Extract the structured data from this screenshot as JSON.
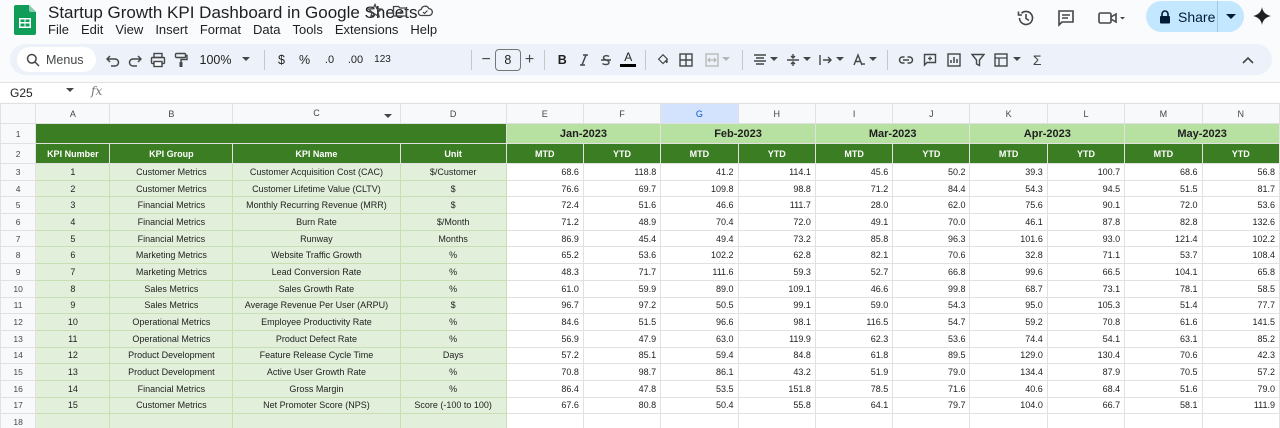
{
  "app": {
    "doc_title": "Startup Growth KPI Dashboard in Google Sheets",
    "menu": [
      "File",
      "Edit",
      "View",
      "Insert",
      "Format",
      "Data",
      "Tools",
      "Extensions",
      "Help"
    ],
    "share_label": "Share",
    "accent": "#3a7d22"
  },
  "toolbar": {
    "menus_label": "Menus",
    "zoom": "100%",
    "currency": "$",
    "percent": "%",
    "dec_decrease": ".0",
    "dec_increase": ".00",
    "number_format": "123",
    "font_size": "8",
    "bold": "B",
    "text_color": "A"
  },
  "formula_bar": {
    "name_box": "G25",
    "fx": "fx"
  },
  "sheet": {
    "columns": [
      "A",
      "B",
      "C",
      "D",
      "E",
      "F",
      "G",
      "H",
      "I",
      "J",
      "K",
      "L",
      "M",
      "N"
    ],
    "row_numbers": [
      "1",
      "2",
      "3",
      "4",
      "5",
      "6",
      "7",
      "8",
      "9",
      "10",
      "11",
      "12",
      "13",
      "14",
      "15",
      "16",
      "17",
      "18"
    ],
    "months": [
      "Jan-2023",
      "Feb-2023",
      "Mar-2023",
      "Apr-2023",
      "May-2023"
    ],
    "headers": {
      "kpi_number": "KPI Number",
      "kpi_group": "KPI Group",
      "kpi_name": "KPI Name",
      "unit": "Unit",
      "mtd": "MTD",
      "ytd": "YTD"
    },
    "rows": [
      {
        "num": "1",
        "group": "Customer Metrics",
        "name": "Customer Acquisition Cost (CAC)",
        "unit": "$/Customer",
        "vals": [
          "68.6",
          "118.8",
          "41.2",
          "114.1",
          "45.6",
          "50.2",
          "39.3",
          "100.7",
          "68.6",
          "56.8"
        ]
      },
      {
        "num": "2",
        "group": "Customer Metrics",
        "name": "Customer Lifetime Value (CLTV)",
        "unit": "$",
        "vals": [
          "76.6",
          "69.7",
          "109.8",
          "98.8",
          "71.2",
          "84.4",
          "54.3",
          "94.5",
          "51.5",
          "81.7"
        ]
      },
      {
        "num": "3",
        "group": "Financial Metrics",
        "name": "Monthly Recurring Revenue (MRR)",
        "unit": "$",
        "vals": [
          "72.4",
          "51.6",
          "46.6",
          "111.7",
          "28.0",
          "62.0",
          "75.6",
          "90.1",
          "72.0",
          "53.6"
        ]
      },
      {
        "num": "4",
        "group": "Financial Metrics",
        "name": "Burn Rate",
        "unit": "$/Month",
        "vals": [
          "71.2",
          "48.9",
          "70.4",
          "72.0",
          "49.1",
          "70.0",
          "46.1",
          "87.8",
          "82.8",
          "132.6"
        ]
      },
      {
        "num": "5",
        "group": "Financial Metrics",
        "name": "Runway",
        "unit": "Months",
        "vals": [
          "86.9",
          "45.4",
          "49.4",
          "73.2",
          "85.8",
          "96.3",
          "101.6",
          "93.0",
          "121.4",
          "102.2"
        ]
      },
      {
        "num": "6",
        "group": "Marketing Metrics",
        "name": "Website Traffic Growth",
        "unit": "%",
        "vals": [
          "65.2",
          "53.6",
          "102.2",
          "62.8",
          "82.1",
          "70.6",
          "32.8",
          "71.1",
          "53.7",
          "108.4"
        ]
      },
      {
        "num": "7",
        "group": "Marketing Metrics",
        "name": "Lead Conversion Rate",
        "unit": "%",
        "vals": [
          "48.3",
          "71.7",
          "111.6",
          "59.3",
          "52.7",
          "66.8",
          "99.6",
          "66.5",
          "104.1",
          "65.8"
        ]
      },
      {
        "num": "8",
        "group": "Sales Metrics",
        "name": "Sales Growth Rate",
        "unit": "%",
        "vals": [
          "61.0",
          "59.9",
          "89.0",
          "109.1",
          "46.6",
          "99.8",
          "68.7",
          "73.1",
          "78.1",
          "58.5"
        ]
      },
      {
        "num": "9",
        "group": "Sales Metrics",
        "name": "Average Revenue Per User (ARPU)",
        "unit": "$",
        "vals": [
          "96.7",
          "97.2",
          "50.5",
          "99.1",
          "59.0",
          "54.3",
          "95.0",
          "105.3",
          "51.4",
          "77.7"
        ]
      },
      {
        "num": "10",
        "group": "Operational Metrics",
        "name": "Employee Productivity Rate",
        "unit": "%",
        "vals": [
          "84.6",
          "51.5",
          "96.6",
          "98.1",
          "116.5",
          "54.7",
          "59.2",
          "70.8",
          "61.6",
          "141.5"
        ]
      },
      {
        "num": "11",
        "group": "Operational Metrics",
        "name": "Product Defect Rate",
        "unit": "%",
        "vals": [
          "56.9",
          "47.9",
          "63.0",
          "119.9",
          "62.3",
          "53.6",
          "74.4",
          "54.1",
          "63.1",
          "85.2"
        ]
      },
      {
        "num": "12",
        "group": "Product Development",
        "name": "Feature Release Cycle Time",
        "unit": "Days",
        "vals": [
          "57.2",
          "85.1",
          "59.4",
          "84.8",
          "61.8",
          "89.5",
          "129.0",
          "130.4",
          "70.6",
          "42.3"
        ]
      },
      {
        "num": "13",
        "group": "Product Development",
        "name": "Active User Growth Rate",
        "unit": "%",
        "vals": [
          "70.8",
          "98.7",
          "86.1",
          "43.2",
          "51.9",
          "79.0",
          "134.4",
          "87.9",
          "70.5",
          "57.2"
        ]
      },
      {
        "num": "14",
        "group": "Financial Metrics",
        "name": "Gross Margin",
        "unit": "%",
        "vals": [
          "86.4",
          "47.8",
          "53.5",
          "151.8",
          "78.5",
          "71.6",
          "40.6",
          "68.4",
          "51.6",
          "79.0"
        ]
      },
      {
        "num": "15",
        "group": "Customer Metrics",
        "name": "Net Promoter Score (NPS)",
        "unit": "Score (-100 to 100)",
        "vals": [
          "67.6",
          "80.8",
          "50.4",
          "55.8",
          "64.1",
          "79.7",
          "104.0",
          "66.7",
          "58.1",
          "111.9"
        ]
      }
    ]
  }
}
